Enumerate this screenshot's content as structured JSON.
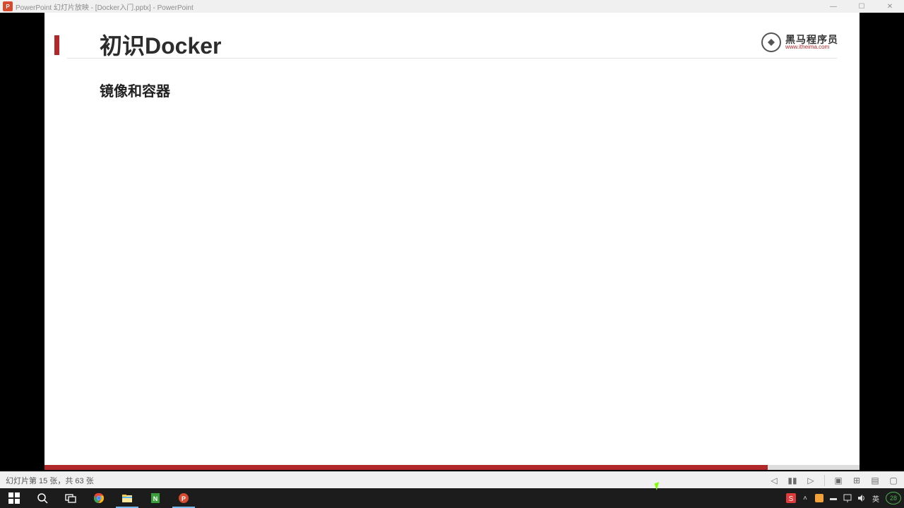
{
  "window": {
    "app_initial": "P",
    "title": "PowerPoint 幻灯片放映 - [Docker入门.pptx] - PowerPoint"
  },
  "slide": {
    "title": "初识Docker",
    "subtitle": "镜像和容器",
    "brand_cn": "黑马程序员",
    "brand_url": "www.itheima.com"
  },
  "statusbar": {
    "slide_info": "幻灯片第 15 张，共 63 张"
  },
  "tray": {
    "ime": "英",
    "date": "28"
  }
}
